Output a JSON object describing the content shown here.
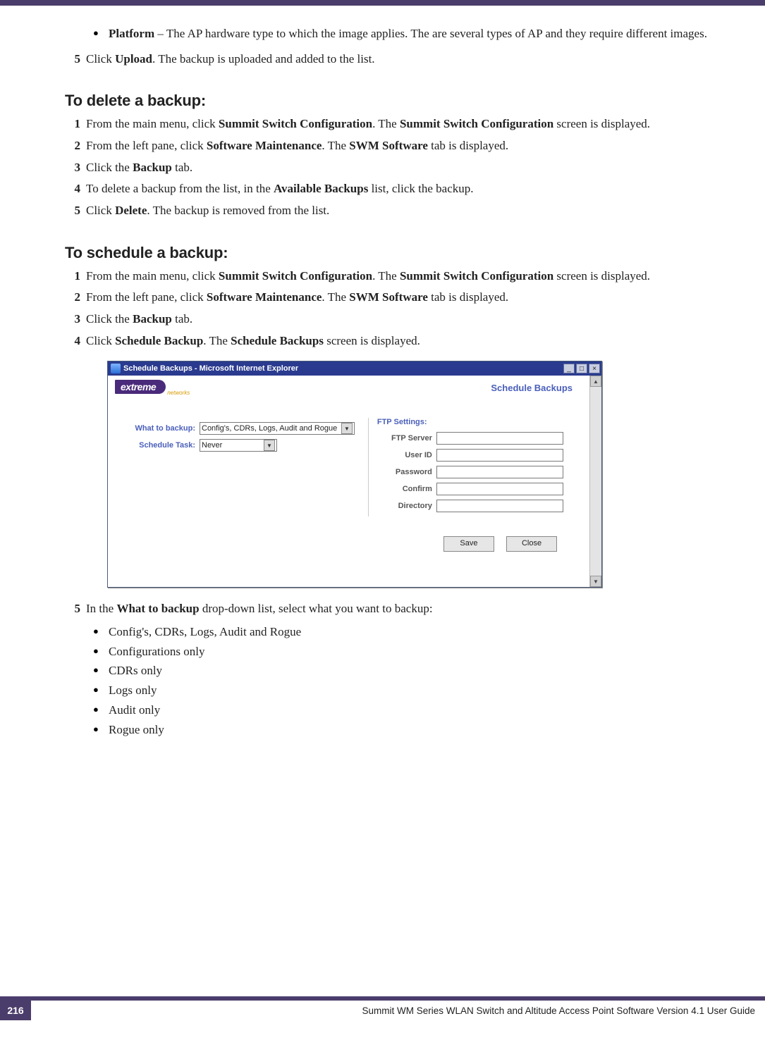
{
  "intro": {
    "bullet_label": "Platform",
    "bullet_text": " – The AP hardware type to which the image applies. The are several types of AP and they require different images.",
    "step5_pre": "Click ",
    "step5_bold": "Upload",
    "step5_post": ". The backup is uploaded and added to the list."
  },
  "delete": {
    "heading": "To delete a backup:",
    "steps": [
      {
        "n": "1",
        "pre": "From the main menu, click ",
        "b1": "Summit Switch Configuration",
        "mid": ". The ",
        "b2": "Summit Switch Configuration",
        "post": " screen is displayed."
      },
      {
        "n": "2",
        "pre": "From the left pane, click ",
        "b1": "Software Maintenance",
        "mid": ". The ",
        "b2": "SWM Software",
        "post": " tab is displayed."
      },
      {
        "n": "3",
        "pre": "Click the ",
        "b1": "Backup",
        "post": " tab."
      },
      {
        "n": "4",
        "pre": "To delete a backup from the list, in the ",
        "b1": "Available Backups",
        "post": " list, click the backup."
      },
      {
        "n": "5",
        "pre": "Click ",
        "b1": "Delete",
        "post": ". The backup is removed from the list."
      }
    ]
  },
  "schedule": {
    "heading": "To schedule a backup:",
    "steps": [
      {
        "n": "1",
        "pre": "From the main menu, click ",
        "b1": "Summit Switch Configuration",
        "mid": ". The ",
        "b2": "Summit Switch Configuration",
        "post": " screen is displayed."
      },
      {
        "n": "2",
        "pre": "From the left pane, click ",
        "b1": "Software Maintenance",
        "mid": ". The ",
        "b2": "SWM Software",
        "post": " tab is displayed."
      },
      {
        "n": "3",
        "pre": "Click the ",
        "b1": "Backup",
        "post": " tab."
      },
      {
        "n": "4",
        "pre": "Click ",
        "b1": "Schedule Backup",
        "mid": ". The ",
        "b2": "Schedule Backups",
        "post": " screen is displayed."
      }
    ],
    "step5": {
      "n": "5",
      "pre": "In the ",
      "b1": "What to backup",
      "post": " drop-down list, select what you want to backup:"
    },
    "options": [
      "Config's, CDRs, Logs, Audit and Rogue",
      "Configurations only",
      "CDRs only",
      "Logs only",
      "Audit only",
      "Rogue only"
    ]
  },
  "dialog": {
    "title": "Schedule Backups - Microsoft Internet Explorer",
    "logo": "extreme",
    "logo_sub": "networks",
    "page_title": "Schedule Backups",
    "left": {
      "what_label": "What to backup:",
      "what_value": "Config's, CDRs, Logs, Audit and Rogue",
      "task_label": "Schedule Task:",
      "task_value": "Never"
    },
    "right": {
      "heading": "FTP Settings:",
      "fields": {
        "server": "FTP Server",
        "user": "User ID",
        "pass": "Password",
        "confirm": "Confirm",
        "dir": "Directory"
      }
    },
    "buttons": {
      "save": "Save",
      "close": "Close"
    }
  },
  "footer": {
    "page": "216",
    "text": "Summit WM Series WLAN Switch and Altitude Access Point Software Version 4.1 User Guide"
  }
}
